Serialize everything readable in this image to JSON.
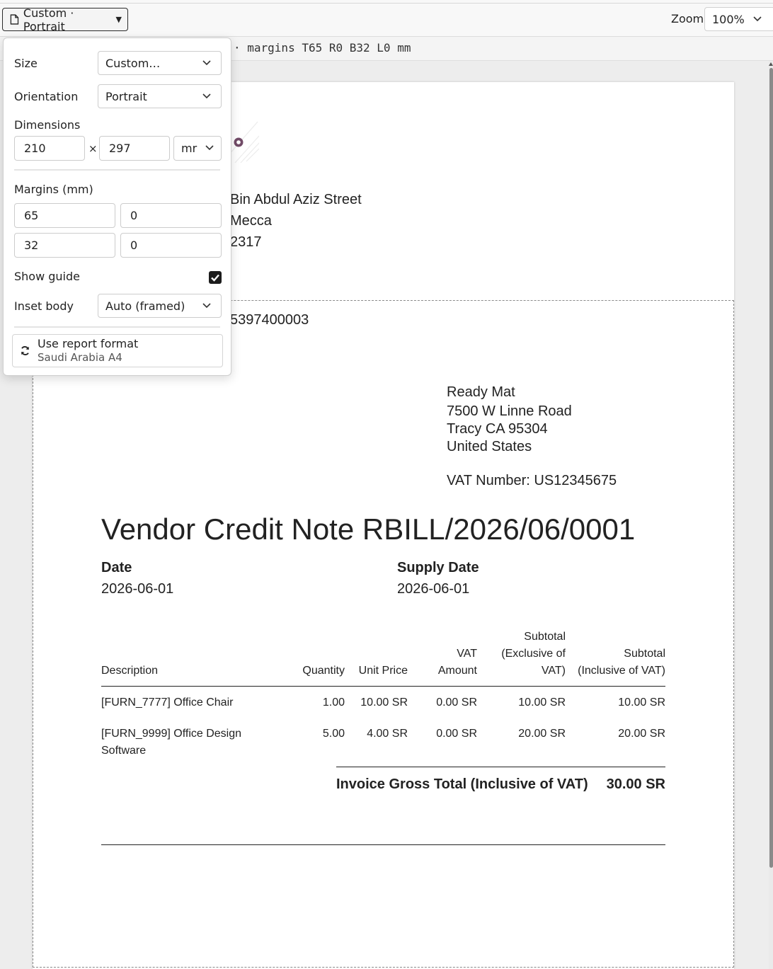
{
  "toolbar": {
    "format_button_label": "Custom · Portrait",
    "zoom_label": "Zoom",
    "zoom_value": "100%"
  },
  "infobar": {
    "text": "· margins T65 R0 B32 L0 mm"
  },
  "popover": {
    "size_label": "Size",
    "size_value": "Custom…",
    "orientation_label": "Orientation",
    "orientation_value": "Portrait",
    "dimensions_label": "Dimensions",
    "width_value": "210",
    "times": "×",
    "height_value": "297",
    "unit_value": "mr",
    "margins_label": "Margins (mm)",
    "margin_top": "65",
    "margin_right": "0",
    "margin_bottom": "32",
    "margin_left": "0",
    "show_guide_label": "Show guide",
    "show_guide_checked": true,
    "inset_body_label": "Inset body",
    "inset_body_value": "Auto (framed)",
    "report_format_title": "Use report format",
    "report_format_subtitle": "Saudi Arabia A4"
  },
  "document": {
    "company_address": [
      "Bin Abdul Aziz Street",
      "Mecca",
      "2317"
    ],
    "company_vat_partial": "5397400003",
    "vendor": {
      "name": "Ready Mat",
      "street": "7500 W Linne Road",
      "city": "Tracy CA 95304",
      "country": "United States",
      "vat": "VAT Number: US12345675"
    },
    "title": "Vendor Credit Note RBILL/2026/06/0001",
    "date_label": "Date",
    "date_value": "2026-06-01",
    "supply_date_label": "Supply Date",
    "supply_date_value": "2026-06-01",
    "table": {
      "headers": {
        "description": "Description",
        "quantity": "Quantity",
        "unit_price": "Unit Price",
        "vat_amount_1": "VAT",
        "vat_amount_2": "Amount",
        "subtotal_excl_1": "Subtotal",
        "subtotal_excl_2": "(Exclusive of",
        "subtotal_excl_3": "VAT)",
        "subtotal_incl_1": "Subtotal",
        "subtotal_incl_2": "(Inclusive of VAT)"
      },
      "rows": [
        {
          "description_1": "[FURN_7777] Office Chair",
          "description_2": "",
          "quantity": "1.00",
          "unit_price": "10.00 SR",
          "vat_amount": "0.00 SR",
          "subtotal_excl": "10.00 SR",
          "subtotal_incl": "10.00 SR"
        },
        {
          "description_1": "[FURN_9999] Office Design",
          "description_2": "Software",
          "quantity": "5.00",
          "unit_price": "4.00 SR",
          "vat_amount": "0.00 SR",
          "subtotal_excl": "20.00 SR",
          "subtotal_incl": "20.00 SR"
        }
      ]
    },
    "total_label": "Invoice Gross Total (Inclusive of VAT)",
    "total_value": "30.00 SR"
  }
}
